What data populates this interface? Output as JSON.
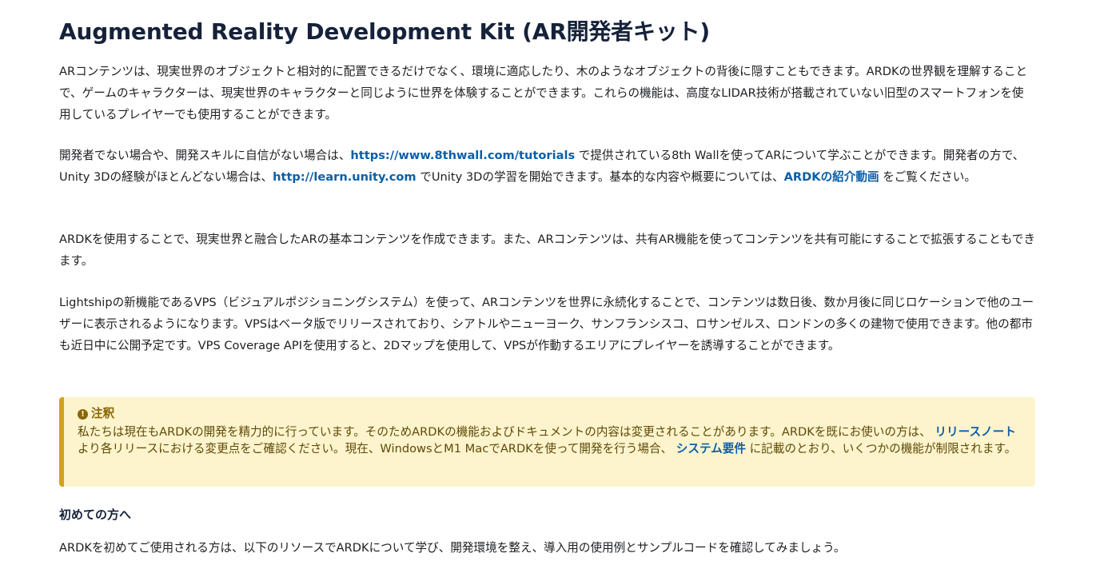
{
  "page": {
    "title": "Augmented Reality Development Kit (AR開発者キット)"
  },
  "paragraphs": {
    "p1": "ARコンテンツは、現実世界のオブジェクトと相対的に配置できるだけでなく、環境に適応したり、木のようなオブジェクトの背後に隠すこともできます。ARDKの世界観を理解することで、ゲームのキャラクターは、現実世界のキャラクターと同じように世界を体験することができます。これらの機能は、高度なLIDAR技術が搭載されていない旧型のスマートフォンを使用しているプレイヤーでも使用することができます。",
    "p2": {
      "part1": "開発者でない場合や、開発スキルに自信がない場合は、",
      "link1": "https://www.8thwall.com/tutorials",
      "part2": " で提供されている8th Wallを使ってARについて学ぶことができます。開発者の方で、Unity 3Dの経験がほとんどない場合は、",
      "link2": "http://learn.unity.com",
      "part3": " でUnity 3Dの学習を開始できます。基本的な内容や概要については、",
      "link3": "ARDKの紹介動画",
      "part4": " をご覧ください。"
    },
    "p3": "ARDKを使用することで、現実世界と融合したARの基本コンテンツを作成できます。また、ARコンテンツは、共有AR機能を使ってコンテンツを共有可能にすることで拡張することもできます。",
    "p4": "Lightshipの新機能であるVPS（ビジュアルポジショニングシステム）を使って、ARコンテンツを世界に永続化することで、コンテンツは数日後、数か月後に同じロケーションで他のユーザーに表示されるようになります。VPSはベータ版でリリースされており、シアトルやニューヨーク、サンフランシスコ、ロサンゼルス、ロンドンの多くの建物で使用できます。他の都市も近日中に公開予定です。VPS Coverage APIを使用すると、2Dマップを使用して、VPSが作動するエリアにプレイヤーを誘導することができます。"
  },
  "note": {
    "icon": "exclamation-circle-icon",
    "title": "注釈",
    "part1": "私たちは現在もARDKの開発を精力的に行っています。そのためARDKの機能およびドキュメントの内容は変更されることがあります。ARDKを既にお使いの方は、 ",
    "link1": "リリースノート",
    "part2": " より各リリースにおける変更点をご確認ください。現在、WindowsとM1 MacでARDKを使って開発を行う場合、 ",
    "link2": "システム要件",
    "part3": " に記載のとおり、いくつかの機能が制限されます。"
  },
  "first_time": {
    "heading": "初めての方へ",
    "text": "ARDKを初めてご使用される方は、以下のリソースでARDKについて学び、開発環境を整え、導入用の使用例とサンプルコードを確認してみましょう。"
  },
  "colors": {
    "link": "#0a5fa8",
    "note_bg": "#fdf4cd",
    "note_border": "#d2a21e",
    "note_text": "#5e4a07",
    "heading": "#15223a"
  }
}
